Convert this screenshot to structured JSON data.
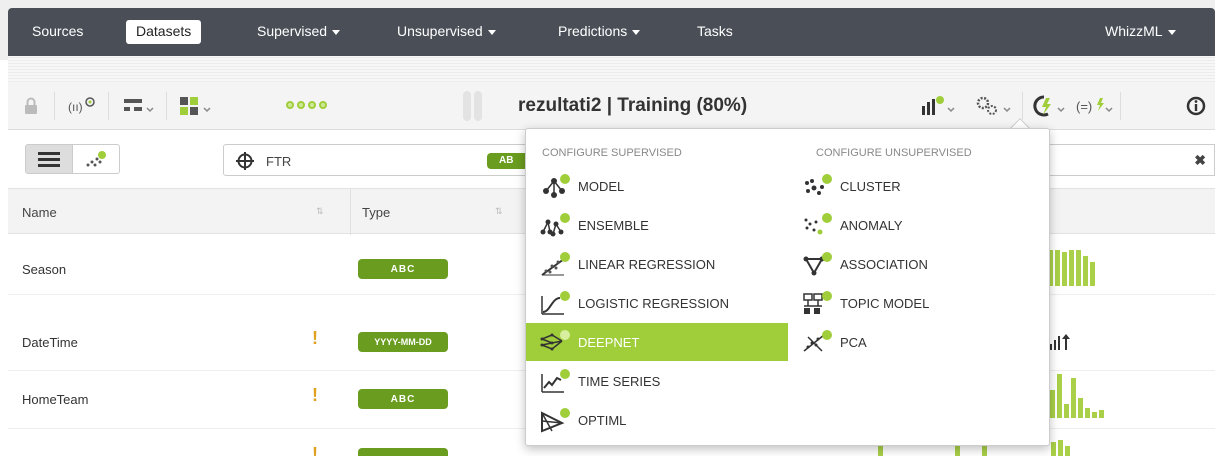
{
  "nav": {
    "items": [
      {
        "label": "Sources"
      },
      {
        "label": "Datasets"
      },
      {
        "label": "Supervised"
      },
      {
        "label": "Unsupervised"
      },
      {
        "label": "Predictions"
      },
      {
        "label": "Tasks"
      }
    ],
    "right": "WhizzML"
  },
  "toolbar": {
    "title": "rezultati2 | Training (80%)"
  },
  "filter": {
    "value": "FTR",
    "badge": "AB"
  },
  "table": {
    "headers": {
      "name": "Name",
      "type": "Type"
    },
    "rows": [
      {
        "name": "Season",
        "type": "ABC",
        "warning": ""
      },
      {
        "name": "DateTime",
        "type": "YYYY-MM-DD",
        "warning": "!"
      },
      {
        "name": "HomeTeam",
        "type": "ABC",
        "warning": "!"
      }
    ]
  },
  "menu": {
    "supervised_title": "CONFIGURE SUPERVISED",
    "unsupervised_title": "CONFIGURE UNSUPERVISED",
    "supervised": [
      {
        "label": "MODEL",
        "icon": "model-icon"
      },
      {
        "label": "ENSEMBLE",
        "icon": "ensemble-icon"
      },
      {
        "label": "LINEAR REGRESSION",
        "icon": "linear-regression-icon"
      },
      {
        "label": "LOGISTIC REGRESSION",
        "icon": "logistic-regression-icon"
      },
      {
        "label": "DEEPNET",
        "icon": "deepnet-icon",
        "highlighted": true
      },
      {
        "label": "TIME SERIES",
        "icon": "time-series-icon"
      },
      {
        "label": "OPTIML",
        "icon": "optiml-icon"
      }
    ],
    "unsupervised": [
      {
        "label": "CLUSTER",
        "icon": "cluster-icon"
      },
      {
        "label": "ANOMALY",
        "icon": "anomaly-icon"
      },
      {
        "label": "ASSOCIATION",
        "icon": "association-icon"
      },
      {
        "label": "TOPIC MODEL",
        "icon": "topic-model-icon"
      },
      {
        "label": "PCA",
        "icon": "pca-icon"
      }
    ]
  },
  "colors": {
    "nav_bg": "#4a4f57",
    "accent": "#9fce3a",
    "badge": "#6a9c1f"
  }
}
